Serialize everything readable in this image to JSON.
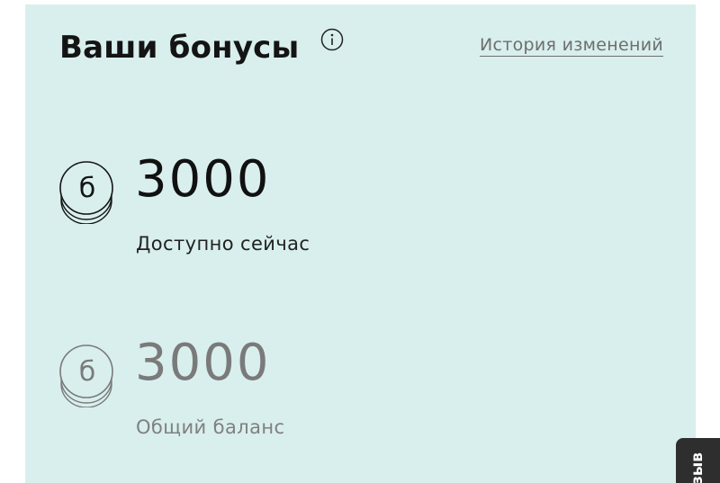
{
  "bonuses": {
    "title": "Ваши бонусы",
    "history_link": "История изменений",
    "available": {
      "amount": "3000",
      "label": "Доступно сейчас",
      "coin_glyph": "б"
    },
    "total": {
      "amount": "3000",
      "label": "Общий баланс",
      "coin_glyph": "б"
    }
  },
  "feedback_tab": {
    "label": "зыв"
  },
  "icons": {
    "info": "info-icon",
    "coin": "bonus-coin-icon"
  },
  "colors": {
    "card_background": "#d8efed",
    "primary_text": "#111111",
    "muted_text": "#7a7a7a",
    "feedback_tab": "#2e2e2e"
  }
}
